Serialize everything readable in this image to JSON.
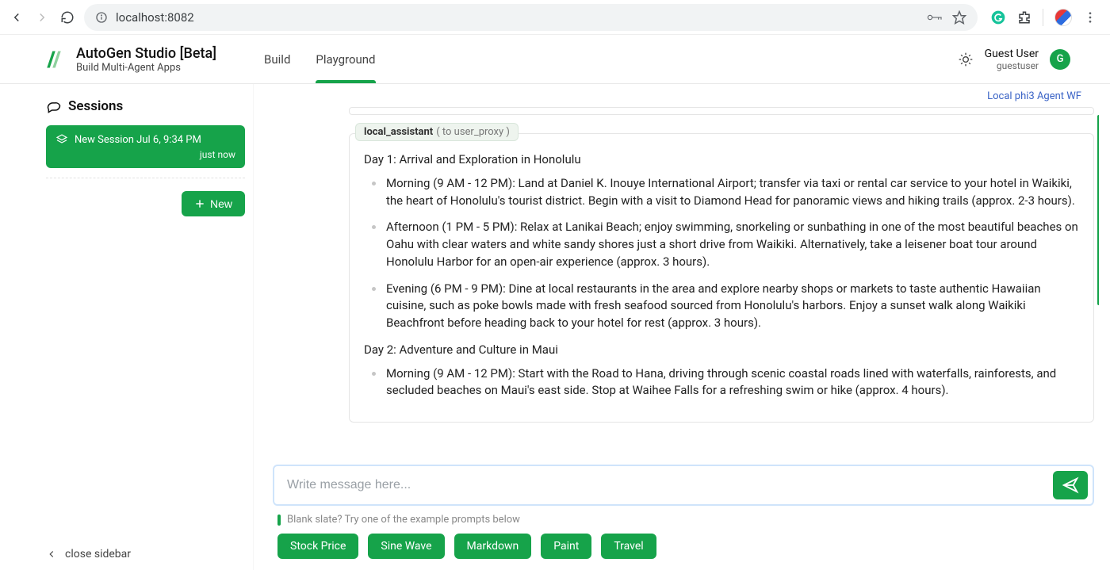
{
  "browser": {
    "url": "localhost:8082"
  },
  "header": {
    "title": "AutoGen Studio [Beta]",
    "subtitle": "Build Multi-Agent Apps",
    "tabs": {
      "build": "Build",
      "playground": "Playground"
    },
    "user_name": "Guest User",
    "user_id": "guestuser",
    "avatar_initial": "G"
  },
  "workflow_label": "Local phi3 Agent WF",
  "sidebar": {
    "title": "Sessions",
    "session": {
      "name": "New Session Jul 6, 9:34 PM",
      "age": "just now"
    },
    "new_button": "New",
    "close": "close sidebar"
  },
  "chat": {
    "from": "local_assistant",
    "to": "( to user_proxy )",
    "day1_title": "Day 1: Arrival and Exploration in Honolulu",
    "day1_items": [
      "Morning (9 AM - 12 PM): Land at Daniel K. Inouye International Airport; transfer via taxi or rental car service to your hotel in Waikiki, the heart of Honolulu's tourist district. Begin with a visit to Diamond Head for panoramic views and hiking trails (approx. 2-3 hours).",
      "Afternoon (1 PM - 5 PM): Relax at Lanikai Beach; enjoy swimming, snorkeling or sunbathing in one of the most beautiful beaches on Oahu with clear waters and white sandy shores just a short drive from Waikiki. Alternatively, take a leisener boat tour around Honolulu Harbor for an open-air experience (approx. 3 hours).",
      "Evening (6 PM - 9 PM): Dine at local restaurants in the area and explore nearby shops or markets to taste authentic Hawaiian cuisine, such as poke bowls made with fresh seafood sourced from Honolulu's harbors. Enjoy a sunset walk along Waikiki Beachfront before heading back to your hotel for rest (approx. 3 hours)."
    ],
    "day2_title": "Day 2: Adventure and Culture in Maui",
    "day2_items": [
      "Morning (9 AM - 12 PM): Start with the Road to Hana, driving through scenic coastal roads lined with waterfalls, rainforests, and secluded beaches on Maui's east side. Stop at Waihee Falls for a refreshing swim or hike (approx. 4 hours)."
    ]
  },
  "input": {
    "placeholder": "Write message here...",
    "hint": "Blank slate? Try one of the example prompts below",
    "prompts": [
      "Stock Price",
      "Sine Wave",
      "Markdown",
      "Paint",
      "Travel"
    ]
  }
}
